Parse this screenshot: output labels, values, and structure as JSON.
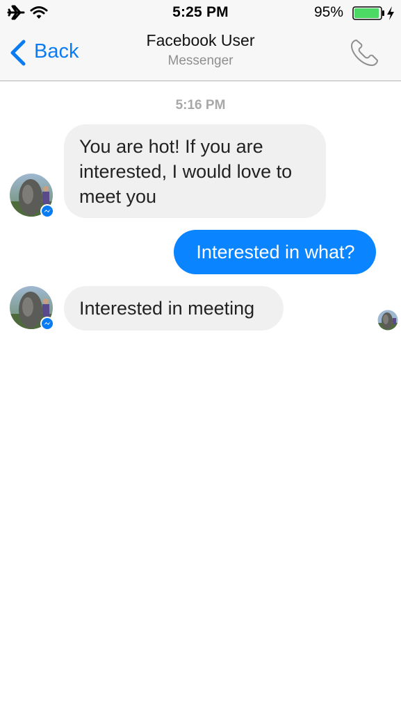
{
  "status_bar": {
    "time": "5:25 PM",
    "battery_percent": "95%",
    "battery_level": 0.95,
    "icons": [
      "airplane-icon",
      "wifi-icon",
      "battery-icon",
      "charging-icon"
    ]
  },
  "nav": {
    "back_label": "Back",
    "title": "Facebook User",
    "subtitle": "Messenger",
    "icons": [
      "chevron-left-icon",
      "phone-icon"
    ],
    "accent_color": "#0a7cf3"
  },
  "conversation": {
    "timestamp": "5:16 PM",
    "messages": [
      {
        "direction": "incoming",
        "text": "You are hot! If you are interested, I would love to meet you"
      },
      {
        "direction": "outgoing",
        "text": "Interested in what?"
      },
      {
        "direction": "incoming",
        "text": "Interested in meeting"
      }
    ],
    "colors": {
      "incoming_bubble": "#f0f0f0",
      "outgoing_bubble": "#0a84ff"
    }
  }
}
